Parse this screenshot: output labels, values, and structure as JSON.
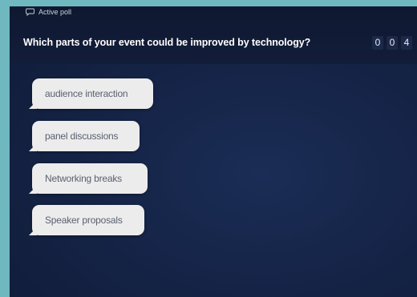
{
  "poll": {
    "status_label": "Active poll",
    "question": "Which parts of your event could be improved by technology?",
    "response_count_digits": [
      "0",
      "0",
      "4"
    ],
    "responses": [
      "audience interaction",
      "panel discussions",
      "Networking breaks",
      "Speaker proposals"
    ]
  },
  "icons": {
    "status": "chat-bubble-icon"
  },
  "colors": {
    "frame": "#6fb8bf",
    "background": "#152447",
    "bubble": "#ececec",
    "bubble_text": "#5a6070"
  }
}
